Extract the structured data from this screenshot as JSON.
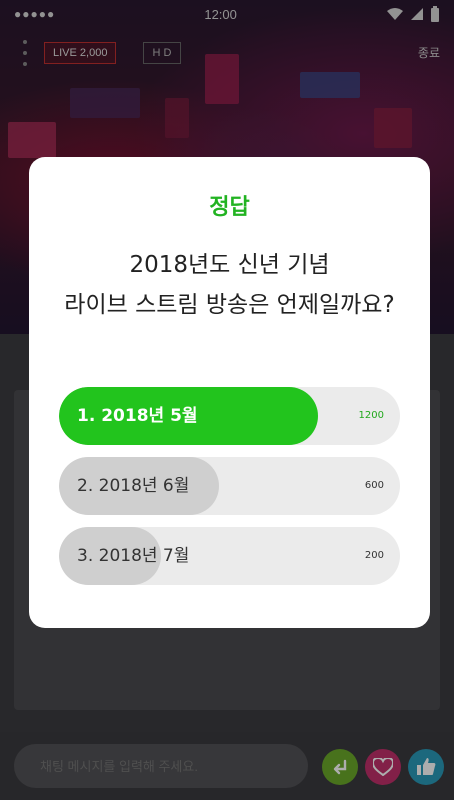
{
  "status_bar": {
    "signal": "●●●●●",
    "time": "12:00"
  },
  "header": {
    "live_label": "LIVE 2,000",
    "hd_label": "H D",
    "end_label": "종료"
  },
  "quiz": {
    "result_title": "정답",
    "question_line1": "2018년도 신년 기념",
    "question_line2": "라이브 스트림 방송은 언제일까요?",
    "options": [
      {
        "label": "1. 2018년 5월",
        "count": "1200",
        "fraction": 0.76,
        "correct": true
      },
      {
        "label": "2. 2018년 6월",
        "count": "600",
        "fraction": 0.47,
        "correct": false
      },
      {
        "label": "3. 2018년 7월",
        "count": "200",
        "fraction": 0.3,
        "correct": false
      }
    ]
  },
  "chat": {
    "placeholder": "채팅 메시지를 입력해 주세요."
  },
  "colors": {
    "correct_fill": "#22c41d",
    "correct_text": "#ffffff",
    "correct_count": "#22a81d",
    "other_fill": "#cfcfcf",
    "other_text": "#333333",
    "send_btn": "#6aa82a",
    "heart_btn": "#c0306a",
    "like_btn": "#2a9ab8"
  },
  "icons": {
    "send": "enter-arrow-icon",
    "heart": "heart-icon",
    "like": "thumbs-up-icon"
  }
}
